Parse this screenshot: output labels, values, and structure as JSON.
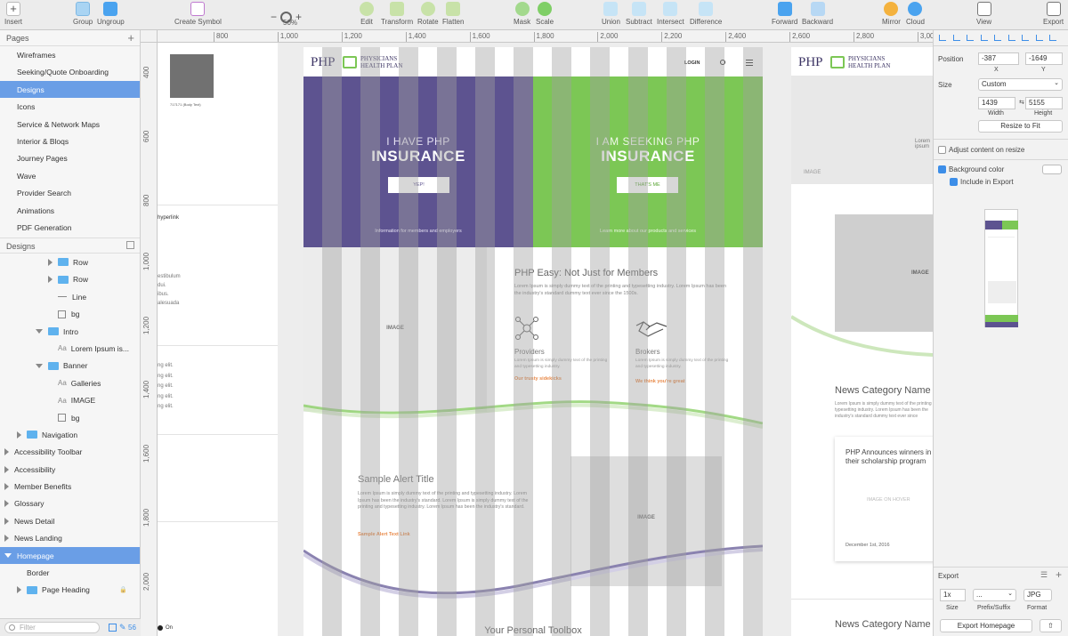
{
  "toolbar": {
    "insert": "Insert",
    "group": "Group",
    "ungroup": "Ungroup",
    "create_symbol": "Create Symbol",
    "zoom": "50%",
    "edit": "Edit",
    "transform": "Transform",
    "rotate": "Rotate",
    "flatten": "Flatten",
    "mask": "Mask",
    "scale": "Scale",
    "union": "Union",
    "subtract": "Subtract",
    "intersect": "Intersect",
    "difference": "Difference",
    "forward": "Forward",
    "backward": "Backward",
    "mirror": "Mirror",
    "cloud": "Cloud",
    "view": "View",
    "export": "Export"
  },
  "ruler": {
    "top": [
      "800",
      "1,000",
      "1,200",
      "1,400",
      "1,600",
      "1,800",
      "2,000",
      "2,200",
      "2,400",
      "2,600",
      "2,800",
      "3,000"
    ],
    "left": [
      "400",
      "600",
      "800",
      "1,000",
      "1,200",
      "1,400",
      "1,600",
      "1,800",
      "2,000"
    ]
  },
  "pages": {
    "header": "Pages",
    "items": [
      "Wireframes",
      "Seeking/Quote Onboarding",
      "Designs",
      "Icons",
      "Service & Network Maps",
      "Interior & Bloqs",
      "Journey Pages",
      "Wave",
      "Provider Search",
      "Animations",
      "PDF Generation"
    ],
    "selected": "Designs"
  },
  "layers": {
    "header": "Designs",
    "items": [
      {
        "label": "Row",
        "indent": 1,
        "kind": "folder",
        "tri": "r"
      },
      {
        "label": "Row",
        "indent": 1,
        "kind": "folder",
        "tri": "r"
      },
      {
        "label": "Line",
        "indent": 1,
        "kind": "line",
        "tri": ""
      },
      {
        "label": "bg",
        "indent": 1,
        "kind": "rect",
        "tri": ""
      },
      {
        "label": "Intro",
        "indent": 0,
        "kind": "folder",
        "tri": "d"
      },
      {
        "label": "Lorem Ipsum is...",
        "indent": 1,
        "kind": "text",
        "tri": ""
      },
      {
        "label": "Banner",
        "indent": 0,
        "kind": "folder",
        "tri": "d"
      },
      {
        "label": "Galleries",
        "indent": 1,
        "kind": "text",
        "tri": ""
      },
      {
        "label": "IMAGE",
        "indent": 1,
        "kind": "text",
        "tri": ""
      },
      {
        "label": "bg",
        "indent": 1,
        "kind": "rect",
        "tri": ""
      },
      {
        "label": "Navigation",
        "indent": -1,
        "kind": "folder",
        "tri": "r"
      },
      {
        "label": "Accessibility Toolbar",
        "indent": -2,
        "kind": "none",
        "tri": "r"
      },
      {
        "label": "Accessibility",
        "indent": -2,
        "kind": "none",
        "tri": "r"
      },
      {
        "label": "Member Benefits",
        "indent": -2,
        "kind": "none",
        "tri": "r"
      },
      {
        "label": "Glossary",
        "indent": -2,
        "kind": "none",
        "tri": "r"
      },
      {
        "label": "News Detail",
        "indent": -2,
        "kind": "none",
        "tri": "r"
      },
      {
        "label": "News Landing",
        "indent": -2,
        "kind": "none",
        "tri": "r"
      },
      {
        "label": "Homepage",
        "indent": -2,
        "kind": "none",
        "tri": "d",
        "sel": true
      },
      {
        "label": "Border",
        "indent": -1,
        "kind": "none",
        "tri": ""
      },
      {
        "label": "Page Heading",
        "indent": -1,
        "kind": "folder",
        "tri": "r",
        "lock": true
      }
    ],
    "filter_placeholder": "Filter",
    "count": "56"
  },
  "canvas": {
    "swatch_caption": "717171 (Body Text)",
    "hyperlink_label": "hyperlink",
    "side_fragments": [
      "estibulum",
      "dui.",
      "ibus.",
      "alesuada"
    ],
    "elit_lines": [
      "ng elit.",
      "ng elit.",
      "ng elit.",
      "ng elit.",
      "ng elit."
    ],
    "on_label": "On",
    "logo_main": "PHP",
    "logo_sub1": "PHYSICIANS",
    "logo_sub2": "HEALTH PLAN",
    "login": "LOGIN",
    "hero_left_small": "I HAVE PHP",
    "hero_left_big": "INSURANCE",
    "hero_left_btn": "YEP!",
    "hero_left_foot": "Information for members and employers",
    "hero_right_small": "I AM SEEKING PHP",
    "hero_right_big": "INSURANCE",
    "hero_right_btn": "THAT'S ME",
    "hero_right_foot": "Learn more about our products and services",
    "image_label": "IMAGE",
    "easy_title": "PHP Easy: Not Just for Members",
    "easy_body": "Lorem Ipsum is simply dummy text of the printing and typesetting industry. Lorem Ipsum has been the industry's standard dummy text ever since the 1500s.",
    "providers_title": "Providers",
    "providers_body": "Lorem Ipsum is simply dummy text of the printing and typesetting industry.",
    "providers_link": "Our trusty sidekicks",
    "brokers_title": "Brokers",
    "brokers_body": "Lorem Ipsum is simply dummy text of the printing and typesetting industry.",
    "brokers_link": "We think you're great",
    "alert_title": "Sample Alert Title",
    "alert_body": "Lorem Ipsum is simply dummy text of the printing and typesetting industry. Lorem Ipsum has been the industry's standard. Lorem Ipsum is simply dummy text of the printing and typesetting industry. Lorem Ipsum has been the industry's standard.",
    "alert_link": "Sample Alert Text Link",
    "toolbox_title": "Your Personal Toolbox",
    "second_image": "IMAGE",
    "second_lorem": "Lorem ipsum",
    "second_image2": "IMAGE",
    "news_category": "News Category Name",
    "news_body": "Lorem Ipsum is simply dummy text of the printing and typesetting industry. Lorem Ipsum has been the industry's standard dummy text ever since",
    "card_title": "PHP Announces winners in their scholarship program",
    "card_hover": "IMAGE ON HOVER",
    "card_date": "December 1st, 2016",
    "news_category2": "News Category Name"
  },
  "inspector": {
    "position_label": "Position",
    "x": "-387",
    "y": "-1649",
    "x_label": "X",
    "y_label": "Y",
    "size_label": "Size",
    "size_preset": "Custom",
    "width": "1439",
    "height": "5155",
    "width_label": "Width",
    "height_label": "Height",
    "resize_btn": "Resize to Fit",
    "adjust_content": "Adjust content on resize",
    "bg_color": "Background color",
    "include_export": "Include in Export",
    "export_header": "Export",
    "export_scale": "1x",
    "export_prefix": "...",
    "export_format": "JPG",
    "size_cap": "Size",
    "prefix_cap": "Prefix/Suffix",
    "format_cap": "Format",
    "export_btn": "Export Homepage"
  }
}
